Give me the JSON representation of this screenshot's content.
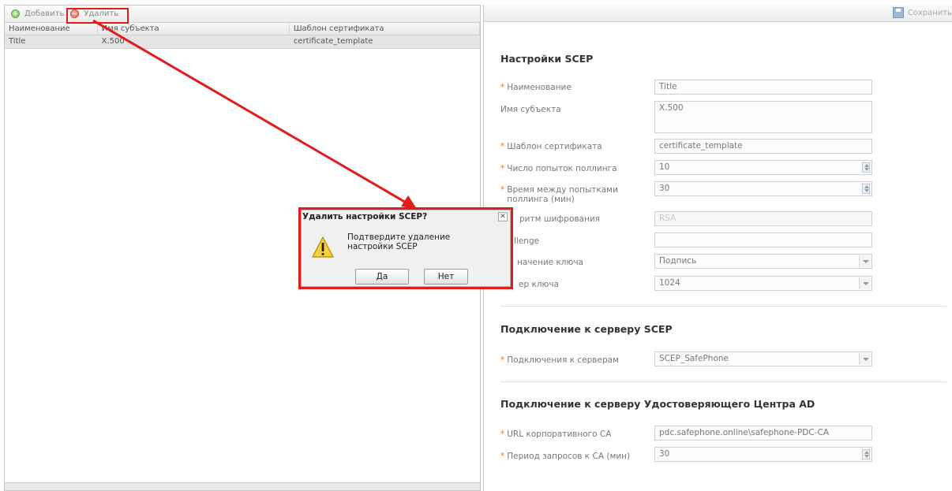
{
  "colors": {
    "annotation": "#e21b1b",
    "required_star": "#e8761b"
  },
  "left": {
    "toolbar": {
      "add_label": "Добавить",
      "add_icon": "add-circle-icon",
      "delete_label": "Удалить",
      "delete_icon": "remove-circle-icon"
    },
    "grid": {
      "columns": [
        "Наименование",
        "Имя субъекта",
        "Шаблон сертификата"
      ],
      "rows": [
        [
          "Title",
          "X.500",
          "certificate_template"
        ]
      ]
    }
  },
  "right": {
    "save_label": "Сохранить",
    "save_icon": "floppy-disk-icon",
    "scep_section": {
      "title": "Настройки SCEP",
      "fields": {
        "name": {
          "label": "Наименование",
          "value": "Title"
        },
        "subject": {
          "label": "Имя субъекта",
          "value": "X.500"
        },
        "template": {
          "label": "Шаблон сертификата",
          "value": "certificate_template"
        },
        "poll_count": {
          "label": "Число попыток поллинга",
          "value": "10"
        },
        "poll_interval": {
          "label": "Время между попытками поллинга (мин)",
          "value": "30"
        },
        "algorithm": {
          "label_visible": "ритм шифрования",
          "value": "RSA"
        },
        "challenge": {
          "label_visible": "llenge",
          "value": ""
        },
        "key_usage": {
          "label_visible": "начение ключа",
          "value": "Подпись"
        },
        "key_size": {
          "label_visible": "ер ключа",
          "value": "1024"
        }
      }
    },
    "server_section": {
      "title": "Подключение к серверу SCEP",
      "connections": {
        "label": "Подключения к серверам",
        "value": "SCEP_SafePhone"
      }
    },
    "ad_section": {
      "title": "Подключение к серверу Удостоверяющего Центра AD",
      "ca_url": {
        "label": "URL корпоративного CA",
        "value": "pdc.safephone.online\\safephone-PDC-CA"
      },
      "ca_period": {
        "label": "Период запросов к CA (мин)",
        "value": "30"
      }
    }
  },
  "dialog": {
    "title": "Удалить настройки SCEP?",
    "message": "Подтвердите удаление настройки SCEP",
    "icon": "warning-icon",
    "close_glyph": "✕",
    "yes_label": "Да",
    "no_label": "Нет"
  }
}
